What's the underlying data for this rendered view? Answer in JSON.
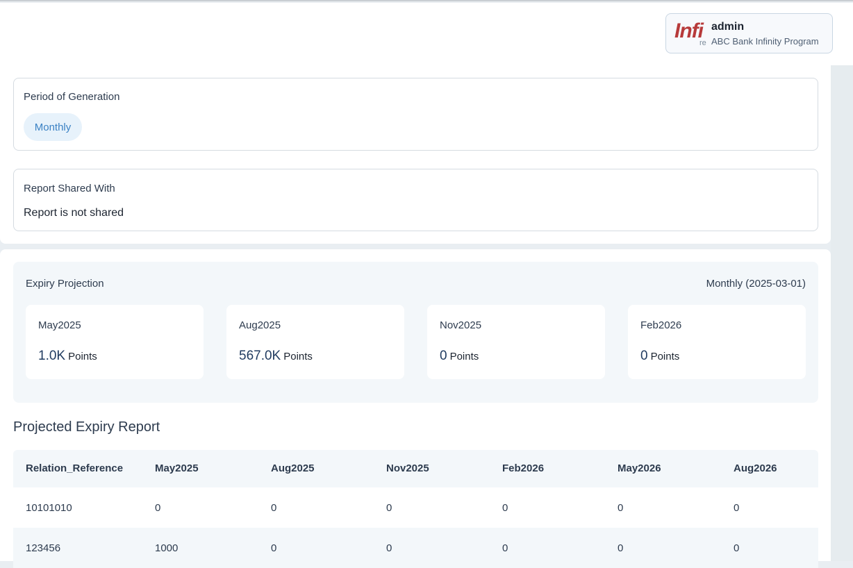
{
  "header": {
    "logo_text": "Infi",
    "logo_subtext": "re",
    "user_name": "admin",
    "program_name": "ABC Bank Infinity Program"
  },
  "period_of_generation": {
    "label": "Period of Generation",
    "value": "Monthly"
  },
  "report_shared_with": {
    "label": "Report Shared With",
    "value": "Report is not shared"
  },
  "expiry_projection": {
    "title": "Expiry Projection",
    "period_label": "Monthly",
    "period_date": "(2025-03-01)",
    "cards": [
      {
        "label": "May2025",
        "value": "1.0K",
        "unit": "Points"
      },
      {
        "label": "Aug2025",
        "value": "567.0K",
        "unit": "Points"
      },
      {
        "label": "Nov2025",
        "value": "0",
        "unit": "Points"
      },
      {
        "label": "Feb2026",
        "value": "0",
        "unit": "Points"
      }
    ]
  },
  "projected_expiry_report": {
    "title": "Projected Expiry Report",
    "columns": [
      "Relation_Reference",
      "May2025",
      "Aug2025",
      "Nov2025",
      "Feb2026",
      "May2026",
      "Aug2026"
    ],
    "rows": [
      [
        "10101010",
        "0",
        "0",
        "0",
        "0",
        "0",
        "0"
      ],
      [
        "123456",
        "1000",
        "0",
        "0",
        "0",
        "0",
        "0"
      ]
    ]
  }
}
